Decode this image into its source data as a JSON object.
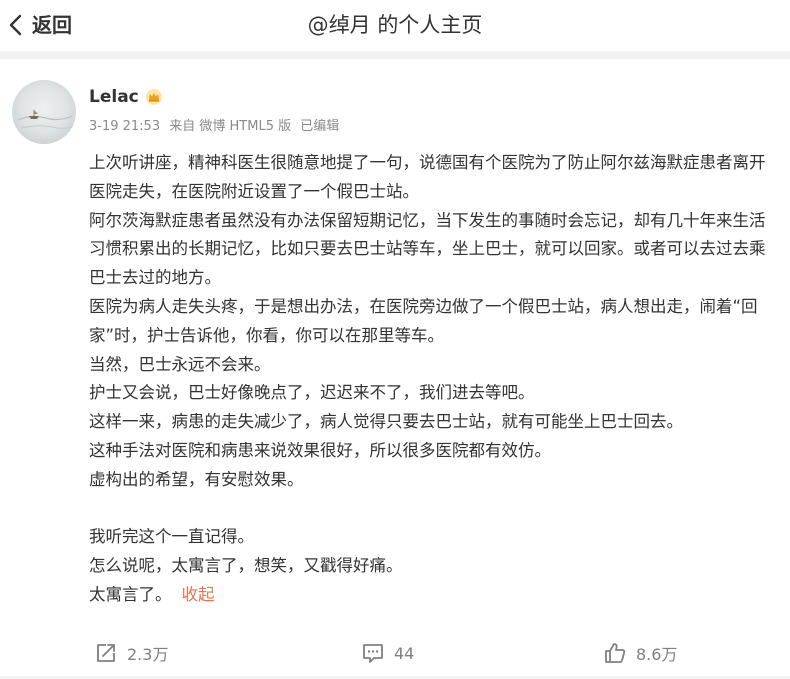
{
  "header": {
    "back_label": "返回",
    "title": "@绰月 的个人主页"
  },
  "post": {
    "username": "Lelac",
    "meta": {
      "date": "3-19 21:53",
      "source": "来自 微博 HTML5 版",
      "edited": "已编辑"
    },
    "paragraphs": [
      "上次听讲座，精神科医生很随意地提了一句，说德国有个医院为了防止阿尔兹海默症患者离开医院走失，在医院附近设置了一个假巴士站。",
      "阿尔茨海默症患者虽然没有办法保留短期记忆，当下发生的事随时会忘记，却有几十年来生活习惯积累出的长期记忆，比如只要去巴士站等车，坐上巴士，就可以回家。或者可以去过去乘巴士去过的地方。",
      "医院为病人走失头疼，于是想出办法，在医院旁边做了一个假巴士站，病人想出走，闹着“回家”时，护士告诉他，你看，你可以在那里等车。",
      "当然，巴士永远不会来。",
      "护士又会说，巴士好像晚点了，迟迟来不了，我们进去等吧。",
      "这样一来，病患的走失减少了，病人觉得只要去巴士站，就有可能坐上巴士回去。",
      "这种手法对医院和病患来说效果很好，所以很多医院都有效仿。",
      "虚构出的希望，有安慰效果。",
      "我听完这个一直记得。",
      "怎么说呢，太寓言了，想笑，又戳得好痛。",
      "太寓言了。"
    ],
    "collapse_label": "收起"
  },
  "actions": {
    "repost_count": "2.3万",
    "comment_count": "44",
    "like_count": "8.6万"
  },
  "colors": {
    "accent": "#eb7350",
    "text": "#333333",
    "meta": "#8a8a8a",
    "icon": "#808080"
  },
  "icons": {
    "back": "chevron-left-icon",
    "badge": "crown-badge-icon",
    "repost": "share-icon",
    "comment": "comment-icon",
    "like": "thumbs-up-icon"
  }
}
